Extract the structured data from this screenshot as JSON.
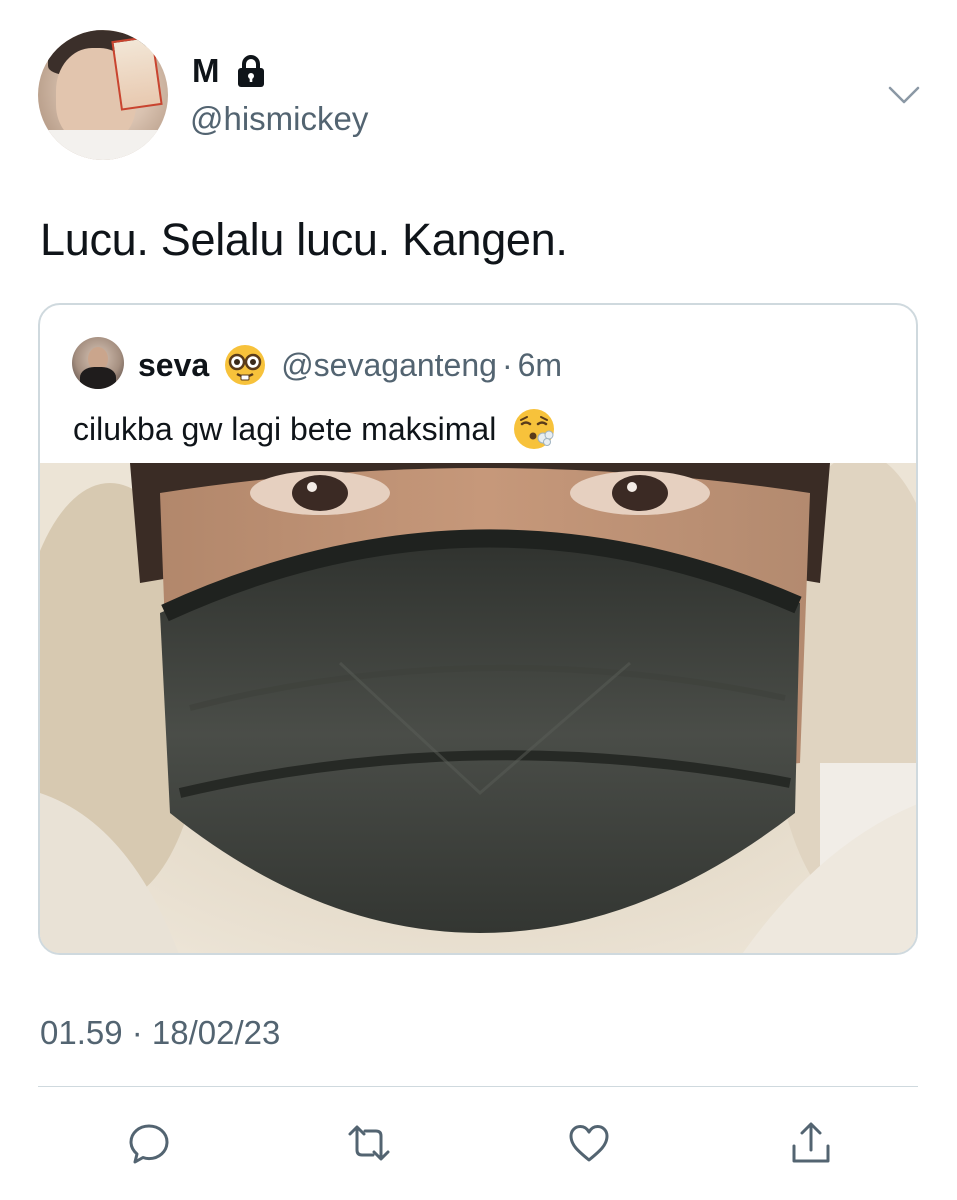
{
  "author": {
    "display_name": "M",
    "handle": "@hismickey",
    "avatar_icon": "profile-photo",
    "locked_icon": "lock-icon"
  },
  "tweet": {
    "text": "Lucu. Selalu lucu. Kangen."
  },
  "quoted_tweet": {
    "name": "seva",
    "name_emoji": "nerd-face-emoji",
    "handle": "@sevaganteng",
    "separator": "·",
    "time": "6m",
    "text": "cilukba gw lagi bete maksimal",
    "text_emoji": "face-exhaling-emoji",
    "photo": "selfie-with-black-face-mask"
  },
  "timestamp": "01.59 · 18/02/23",
  "actions": [
    {
      "name": "reply",
      "icon": "reply-icon"
    },
    {
      "name": "retweet",
      "icon": "retweet-icon"
    },
    {
      "name": "like",
      "icon": "heart-icon"
    },
    {
      "name": "share",
      "icon": "share-icon"
    }
  ],
  "colors": {
    "text_primary": "#0f1419",
    "text_secondary": "#536471",
    "border": "#cfd9de",
    "icon": "#536471"
  }
}
